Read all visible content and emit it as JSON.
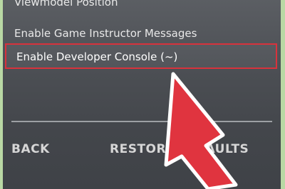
{
  "menu": {
    "items": [
      {
        "label": "Viewmodel Position"
      },
      {
        "label": "Enable Game Instructor Messages"
      },
      {
        "label": "Enable Developer Console (~)"
      }
    ]
  },
  "footer": {
    "back_label": "BACK",
    "restore_label": "RESTORE DEFAULTS"
  },
  "colors": {
    "highlight": "#d8323c",
    "arrow": "#e0343f",
    "frame": "#b9d8a4"
  }
}
